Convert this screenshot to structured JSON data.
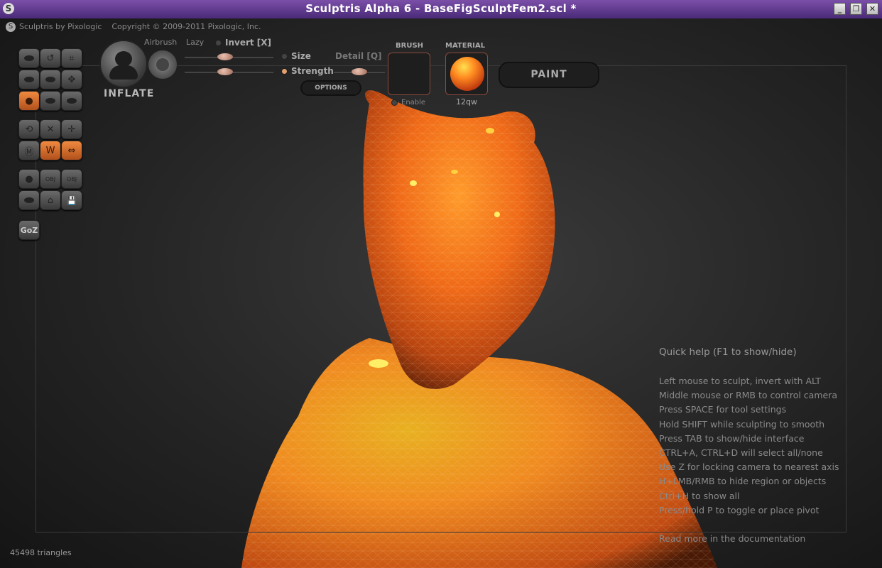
{
  "window": {
    "title": "Sculptris Alpha 6 - BaseFigSculptFem2.scl *",
    "app_icon": "sculptris-logo",
    "buttons": {
      "minimize": "_",
      "maximize": "❐",
      "close": "✕"
    }
  },
  "header": {
    "brand": "Sculptris by Pixologic",
    "copyright": "Copyright © 2009-2011 Pixologic, Inc."
  },
  "toolbar": {
    "tools": [
      {
        "name": "draw-tool",
        "glyph": "▬"
      },
      {
        "name": "undo-tool",
        "glyph": "↺"
      },
      {
        "name": "crop-tool",
        "glyph": "⌗"
      },
      {
        "name": "flatten-tool",
        "glyph": "▬"
      },
      {
        "name": "crease-tool",
        "glyph": "▬"
      },
      {
        "name": "grab-tool",
        "glyph": "✥"
      },
      {
        "name": "inflate-tool",
        "glyph": "●"
      },
      {
        "name": "pinch-tool",
        "glyph": "▬"
      },
      {
        "name": "smooth-tool",
        "glyph": "▬"
      },
      {
        "name": "rotate-tool",
        "glyph": "⟲"
      },
      {
        "name": "scale-tool",
        "glyph": "✕"
      },
      {
        "name": "move-tool",
        "glyph": "✛"
      },
      {
        "name": "mask-tool",
        "glyph": "Ⓜ"
      },
      {
        "name": "wireframe-tool",
        "glyph": "W"
      },
      {
        "name": "symmetry-tool",
        "glyph": "⇔"
      },
      {
        "name": "new-sphere-tool",
        "glyph": "●"
      },
      {
        "name": "import-obj-tool",
        "glyph": "OBJ"
      },
      {
        "name": "export-obj-tool",
        "glyph": "OBJ"
      },
      {
        "name": "new-plane-tool",
        "glyph": "▬"
      },
      {
        "name": "open-file-tool",
        "glyph": "⌂"
      },
      {
        "name": "save-file-tool",
        "glyph": "💾"
      },
      {
        "name": "goz-button",
        "glyph": "GoZ"
      }
    ],
    "active_brush": "INFLATE",
    "airbrush_label": "Airbrush",
    "lazy_label": "Lazy",
    "invert_label": "Invert [X]",
    "size_label": "Size",
    "detail_label": "Detail [Q]",
    "strength_label": "Strength",
    "options_label": "OPTIONS",
    "brush_label": "BRUSH",
    "enable_label": "Enable",
    "material_label": "MATERIAL",
    "material_name": "12qw",
    "paint_label": "PAINT",
    "size_value": 0.45,
    "lazy_value": 0.45,
    "strength_value": 0.45,
    "detail_value": 0.5
  },
  "help": {
    "heading": "Quick help (F1 to show/hide)",
    "lines": [
      "Left mouse to sculpt, invert with ALT",
      "Middle mouse or RMB to control camera",
      "Press SPACE for tool settings",
      "Hold SHIFT while sculpting to smooth",
      "Press TAB to show/hide interface",
      "CTRL+A, CTRL+D will select all/none",
      "Use Z for locking camera to nearest axis",
      "H+LMB/RMB to hide region or objects",
      "Ctrl+H to show all",
      "Press/hold P to toggle or place pivot"
    ],
    "more": "Read more in the documentation"
  },
  "status": {
    "triangles": "45498 triangles"
  },
  "colors": {
    "accent": "#e07030",
    "title_bar": "#5a3590",
    "material": "#ff8a20"
  }
}
